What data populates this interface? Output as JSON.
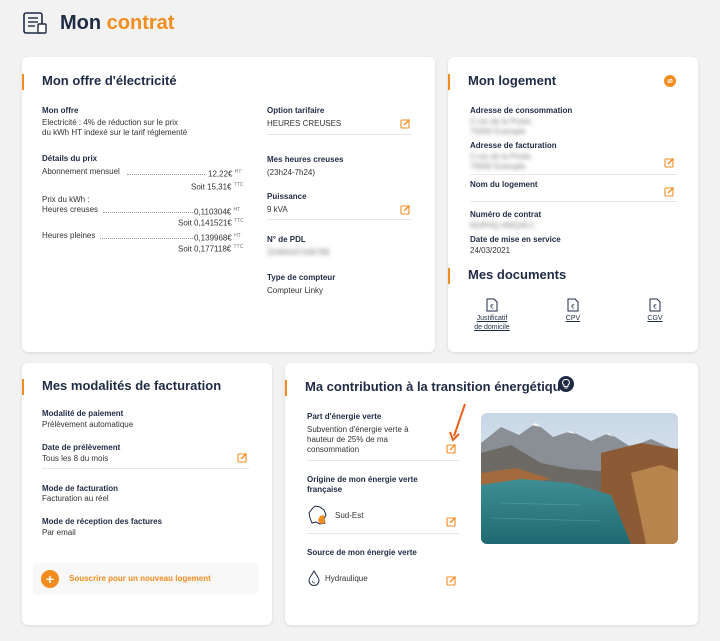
{
  "header": {
    "title_main": "Mon",
    "title_accent": "contrat"
  },
  "offre": {
    "title": "Mon offre d'électricité",
    "mon_offre_label": "Mon offre",
    "mon_offre_line1": "Electricité : 4% de réduction sur le prix",
    "mon_offre_line2": "du kWh HT indexé sur le tarif réglementé",
    "details_label": "Détails du prix",
    "abonnement_label": "Abonnement mensuel",
    "abonnement_value": "12,22€",
    "abonnement_value_unit": "HT",
    "abonnement_ttc": "Soit 15,31€",
    "abonnement_ttc_unit": "TTC",
    "prix_kwh_label": "Prix du kWh :",
    "hc_label": "Heures creuses",
    "hc_value": "0,110304€",
    "hc_value_unit": "HT",
    "hc_ttc": "Soit 0,141521€",
    "hc_ttc_unit": "TTC",
    "hp_label": "Heures pleines",
    "hp_value": "0,139968€",
    "hp_value_unit": "HT",
    "hp_ttc": "Soit 0,177118€",
    "hp_ttc_unit": "TTC",
    "option_label": "Option tarifaire",
    "option_value": "HEURES CREUSES",
    "heures_creuses_label": "Mes heures creuses",
    "heures_creuses_value": "(23h24-7h24)",
    "puissance_label": "Puissance",
    "puissance_value": "9 kVA",
    "pdl_label": "N° de PDL",
    "pdl_value": "25494347436788",
    "compteur_label": "Type de compteur",
    "compteur_value": "Compteur Linky"
  },
  "logement": {
    "title": "Mon logement",
    "adresse_conso_label": "Adresse de consommation",
    "adresse_conso_line1": "2 rue de la Poste,",
    "adresse_conso_line2": "75000 Exemple",
    "adresse_fact_label": "Adresse de facturation",
    "adresse_fact_line1": "2 rue de la Poste,",
    "adresse_fact_line2": "75000 Exemple",
    "nom_label": "Nom du logement",
    "contrat_label": "Numéro de contrat",
    "contrat_value": "NUPHQ-AWQ4LC",
    "mise_en_service_label": "Date de mise en service",
    "mise_en_service_value": "24/03/2021"
  },
  "documents": {
    "title": "Mes documents",
    "items": [
      {
        "line1": "Justificatif",
        "line2": "de domicile"
      },
      {
        "line1": "CPV",
        "line2": ""
      },
      {
        "line1": "CGV",
        "line2": ""
      }
    ]
  },
  "facturation": {
    "title": "Mes modalités de facturation",
    "paiement_label": "Modalité de paiement",
    "paiement_value": "Prélèvement automatique",
    "prelevement_label": "Date de prélèvement",
    "prelevement_value": "Tous les 8 du mois",
    "mode_label": "Mode de facturation",
    "mode_value": "Facturation au réel",
    "reception_label": "Mode de réception des factures",
    "reception_value": "Par email",
    "subscribe_label": "Souscrire pour un nouveau logement"
  },
  "transition": {
    "title": "Ma contribution à la transition énergétique",
    "part_label": "Part d'énergie verte",
    "part_line1": "Subvention d'énergie verte à",
    "part_line2": "hauteur de 25% de ma",
    "part_line3": "consommation",
    "origine_label_line1": "Origine de mon énergie verte",
    "origine_label_line2": "française",
    "origine_value": "Sud-Est",
    "source_label": "Source de mon énergie verte",
    "source_value": "Hydraulique"
  },
  "colors": {
    "accent": "#f28c1e",
    "navy": "#1f2a44",
    "background": "#f2f2f2"
  }
}
